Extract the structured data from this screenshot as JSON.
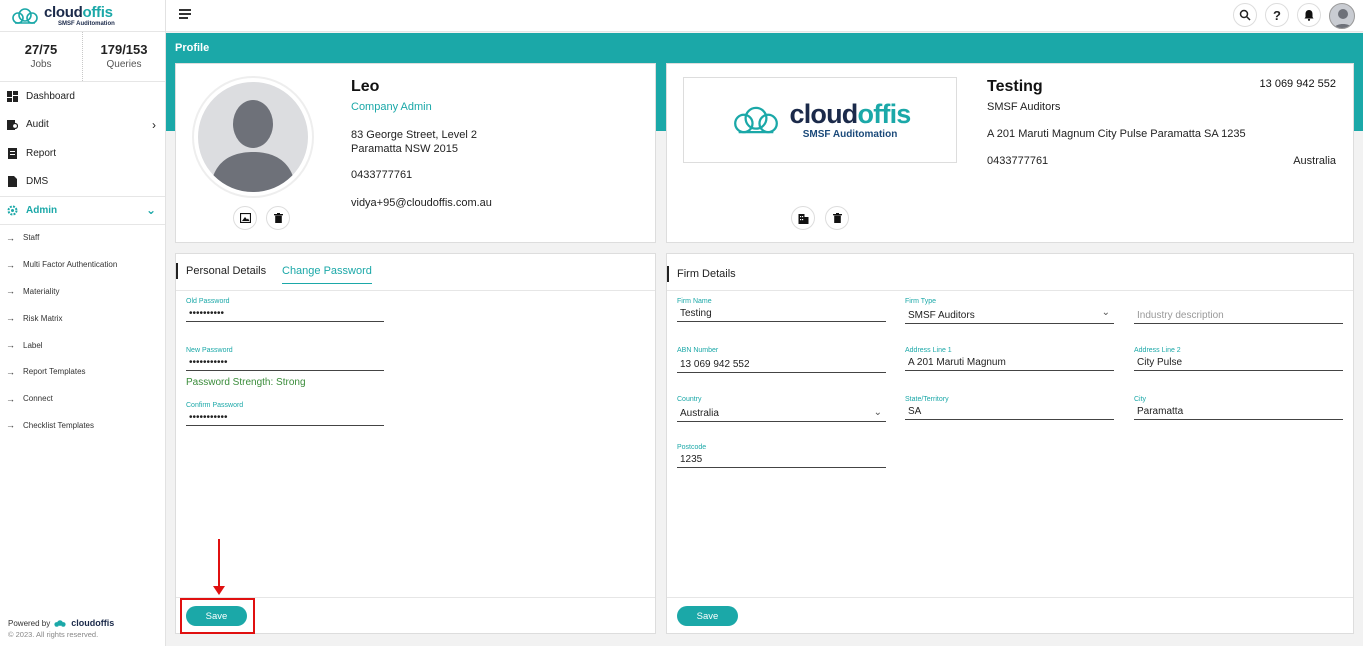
{
  "sidebar": {
    "logo": {
      "name_a": "cloud",
      "name_b": "offis",
      "subtitle": "SMSF Auditomation"
    },
    "stats": [
      {
        "value": "27/75",
        "label": "Jobs"
      },
      {
        "value": "179/153",
        "label": "Queries"
      }
    ],
    "nav": [
      {
        "label": "Dashboard",
        "icon": "grid-icon"
      },
      {
        "label": "Audit",
        "icon": "audit-icon",
        "chevron": "›"
      },
      {
        "label": "Report",
        "icon": "report-icon"
      },
      {
        "label": "DMS",
        "icon": "document-icon"
      },
      {
        "label": "Admin",
        "icon": "gear-icon",
        "chevron": "⌄"
      }
    ],
    "admin_items": [
      "Staff",
      "Multi Factor Authentication",
      "Materiality",
      "Risk Matrix",
      "Label",
      "Report Templates",
      "Connect",
      "Checklist Templates"
    ],
    "powered_by": "Powered by",
    "powered_brand": "cloudoffis",
    "copyright": "© 2023. All rights reserved."
  },
  "page_title": "Profile",
  "profile": {
    "name": "Leo",
    "role": "Company Admin",
    "address_line1": "83 George Street, Level 2",
    "address_line2": "Paramatta NSW 2015",
    "phone": "0433777761",
    "email": "vidya+95@cloudoffis.com.au"
  },
  "firm": {
    "logo": {
      "name_a": "cloud",
      "name_b": "offis",
      "subtitle": "SMSF Auditomation"
    },
    "name": "Testing",
    "type": "SMSF Auditors",
    "address": "A 201 Maruti Magnum City Pulse Paramatta SA 1235",
    "phone": "0433777761",
    "abn": "13 069 942 552",
    "country": "Australia"
  },
  "personal_tabs": {
    "personal": "Personal Details",
    "password": "Change Password"
  },
  "password_form": {
    "old": {
      "label": "Old Password",
      "value": "••••••••••"
    },
    "new": {
      "label": "New Password",
      "value": "•••••••••••"
    },
    "strength": "Password Strength: Strong",
    "confirm": {
      "label": "Confirm Password",
      "value": "•••••••••••"
    },
    "save": "Save"
  },
  "firm_details": {
    "title": "Firm Details",
    "firm_name": {
      "label": "Firm Name",
      "value": "Testing"
    },
    "firm_type": {
      "label": "Firm Type",
      "value": "SMSF Auditors"
    },
    "industry": {
      "placeholder": "Industry description"
    },
    "abn": {
      "label": "ABN Number",
      "value": "13 069 942 552"
    },
    "address1": {
      "label": "Address Line 1",
      "value": "A 201 Maruti Magnum"
    },
    "address2": {
      "label": "Address Line 2",
      "value": "City Pulse"
    },
    "country": {
      "label": "Country",
      "value": "Australia"
    },
    "state": {
      "label": "State/Territory",
      "value": "SA"
    },
    "city": {
      "label": "City",
      "value": "Paramatta"
    },
    "postcode": {
      "label": "Postcode",
      "value": "1235"
    },
    "save": "Save"
  },
  "colors": {
    "accent": "#1ba8a8",
    "annotation": "#e01010"
  }
}
